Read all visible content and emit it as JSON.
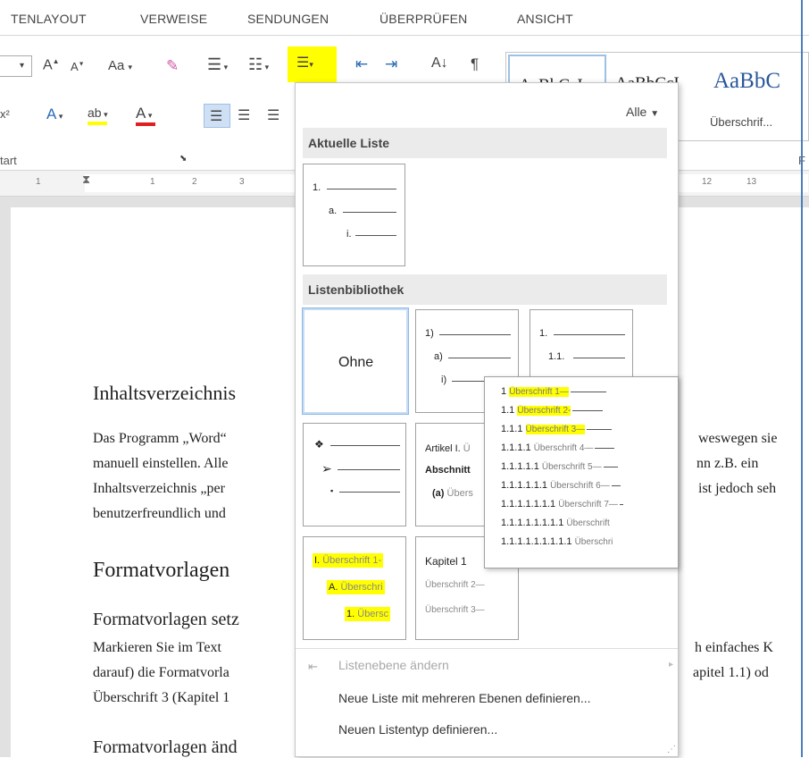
{
  "tabs": [
    "TENLAYOUT",
    "VERWEISE",
    "SENDUNGEN",
    "ÜBERPRÜFEN",
    "ANSICHT"
  ],
  "ribbon": {
    "font_grow": "A",
    "font_shrink": "A",
    "case_button": "Aa",
    "group_label_start": "tart",
    "group_label_f": "F",
    "styles": [
      "AaBbCcI",
      "AaBbCcI",
      "AaBbC"
    ],
    "styles_caption": "Überschrif...",
    "highlight_color": "#ffff00",
    "font_color": "#e02020"
  },
  "ruler": {
    "left_numbers": [
      "1",
      "1",
      "2",
      "3"
    ],
    "right_numbers": [
      "12",
      "13"
    ]
  },
  "document": {
    "heading1": "Inhaltsverzeichnis",
    "para1_l1": "Das Programm „Word“",
    "para1_l1_right": "weswegen sie",
    "para1_l2": "manuell einstellen. Alle",
    "para1_l2_right": "nn z.B. ein",
    "para1_l3": "Inhaltsverzeichnis „per",
    "para1_l3_right": "ist jedoch seh",
    "para1_l4": "benutzerfreundlich und",
    "heading2": "Formatvorlagen",
    "heading3": "Formatvorlagen setz",
    "para2_l1": "Markieren Sie im Text",
    "para2_l1_right": "h einfaches K",
    "para2_l2": "darauf) die Formatvorla",
    "para2_l2_right": "apitel 1.1) od",
    "para2_l3": "Überschrift 3 (Kapitel 1",
    "heading4": "Formatvorlagen änd"
  },
  "panel": {
    "filter_label": "Alle",
    "section_current": "Aktuelle Liste",
    "current": {
      "l1": "1.",
      "l2": "a.",
      "l3": "i."
    },
    "section_library": "Listenbibliothek",
    "none_label": "Ohne",
    "tile_numbered": {
      "l1": "1)",
      "l2": "a)",
      "l3": "i)"
    },
    "tile_decimal": {
      "l1": "1.",
      "l2": "1.1."
    },
    "tile_bullets": {
      "l1": "❖",
      "l2": "➢",
      "l3": "▪"
    },
    "tile_article": {
      "l1": "Artikel I.",
      "l1_t": "Ü",
      "l2": "Abschnitt",
      "l3": "(a)",
      "l3_t": "Übers"
    },
    "tile_roman": {
      "l1": "I.",
      "l1_t": "Überschrift 1-",
      "l2": "A.",
      "l2_t": "Überschri",
      "l3": "1.",
      "l3_t": "Übersc"
    },
    "tile_kapitel": {
      "l1": "Kapitel 1",
      "l2": "Überschrift 2—",
      "l3": "Überschrift 3—"
    },
    "flyout": [
      {
        "num": "1",
        "text": "Überschrift 1—",
        "highlight": true
      },
      {
        "num": "1.1",
        "text": "Überschrift 2-",
        "highlight": true
      },
      {
        "num": "1.1.1",
        "text": "Überschrift 3—",
        "highlight": true
      },
      {
        "num": "1.1.1.1",
        "text": "Überschrift 4—",
        "highlight": false
      },
      {
        "num": "1.1.1.1.1",
        "text": "Überschrift 5—",
        "highlight": false
      },
      {
        "num": "1.1.1.1.1.1",
        "text": "Überschrift 6—",
        "highlight": false
      },
      {
        "num": "1.1.1.1.1.1.1",
        "text": "Überschrift 7—",
        "highlight": false
      },
      {
        "num": "1.1.1.1.1.1.1.1",
        "text": "Überschrift",
        "highlight": false
      },
      {
        "num": "1.1.1.1.1.1.1.1.1",
        "text": "Überschri",
        "highlight": false
      }
    ],
    "menu_change_level": "Listenebene ändern",
    "menu_define_multilevel": "Neue Liste mit mehreren Ebenen definieren...",
    "menu_define_style": "Neuen Listentyp definieren..."
  }
}
